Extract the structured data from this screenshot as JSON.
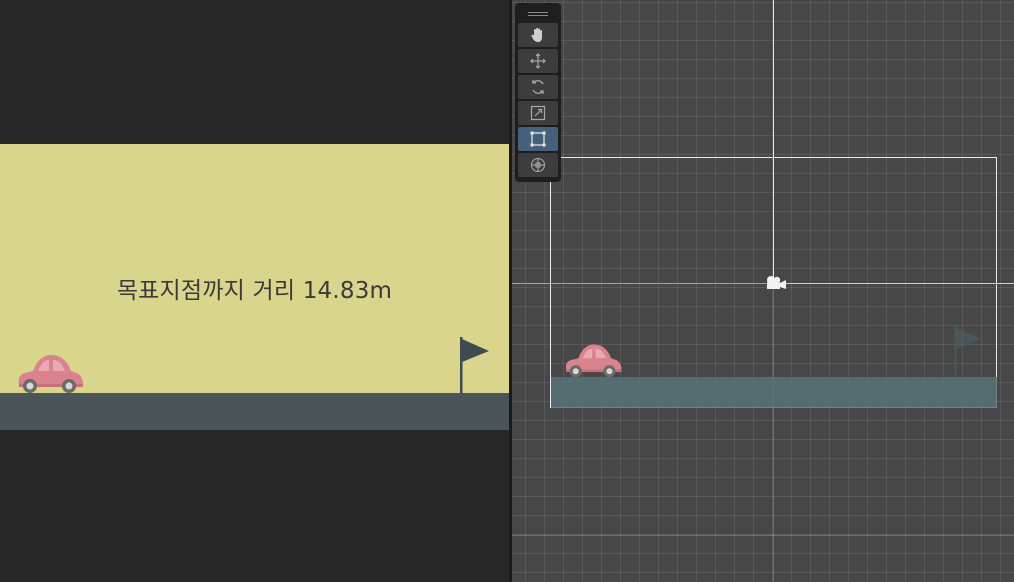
{
  "game": {
    "distance_text": "목표지점까지 거리 14.83m",
    "colors": {
      "sky": "#dad58c",
      "ground": "#4a5559",
      "car": "#d9838e",
      "flag": "#3f4b50"
    }
  },
  "scene": {
    "colors": {
      "background": "#474747",
      "ground": "#577278",
      "camera_frame": "#e9e9e9"
    }
  },
  "toolbar": {
    "tools": [
      {
        "name": "hand",
        "icon": "hand-icon",
        "active": false
      },
      {
        "name": "move",
        "icon": "move-icon",
        "active": false
      },
      {
        "name": "rotate",
        "icon": "rotate-icon",
        "active": false
      },
      {
        "name": "scale",
        "icon": "scale-icon",
        "active": false
      },
      {
        "name": "rect",
        "icon": "rect-transform-icon",
        "active": true
      },
      {
        "name": "transform",
        "icon": "transform-icon",
        "active": false
      }
    ]
  }
}
